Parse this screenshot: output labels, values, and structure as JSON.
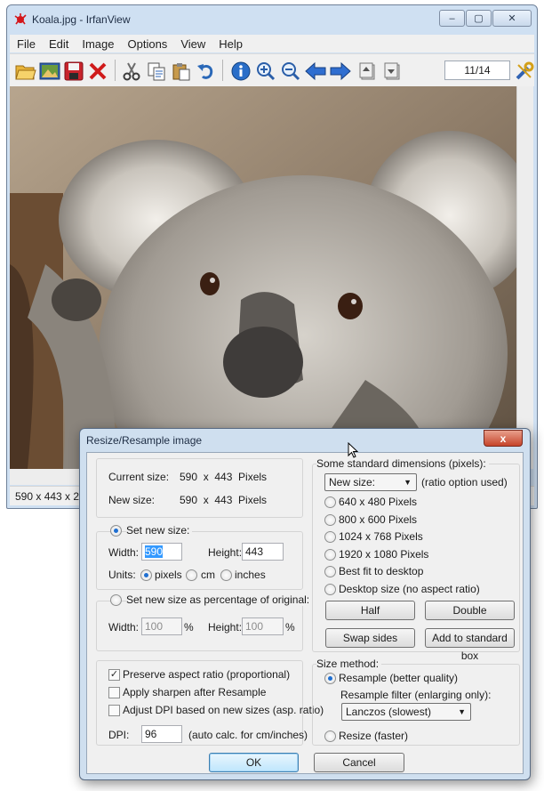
{
  "window": {
    "title": "Koala.jpg - IrfanView",
    "caption_buttons": [
      "‒",
      "▢",
      "✕"
    ]
  },
  "menu": [
    "File",
    "Edit",
    "Image",
    "Options",
    "View",
    "Help"
  ],
  "toolbar": {
    "icons": [
      "open-icon",
      "thumbnails-icon",
      "save-icon",
      "delete-icon",
      "cut-icon",
      "copy-icon",
      "paste-icon",
      "undo-icon",
      "info-icon",
      "zoom-in-icon",
      "zoom-out-icon",
      "previous-icon",
      "next-icon",
      "first-page-icon",
      "last-page-icon",
      "settings-icon"
    ],
    "page_counter": "11/14"
  },
  "status": {
    "text": "590 x 443 x 24"
  },
  "dialog": {
    "title": "Resize/Resample image",
    "close": "x",
    "current_size_label": "Current size:",
    "current_size_value": "590  x  443  Pixels",
    "new_size_label": "New size:",
    "new_size_value": "590  x  443  Pixels",
    "set_new_size": {
      "label": "Set new size:",
      "selected": true,
      "width_label": "Width:",
      "width_value": "590",
      "height_label": "Height:",
      "height_value": "443",
      "units_label": "Units:",
      "units": [
        "pixels",
        "cm",
        "inches"
      ],
      "selected_unit": "pixels"
    },
    "set_percentage": {
      "label": "Set new size as percentage of original:",
      "selected": false,
      "width_label": "Width:",
      "width_value": "100",
      "height_label": "Height:",
      "height_value": "100",
      "percent": "%"
    },
    "standard": {
      "label": "Some standard dimensions (pixels):",
      "combo_value": "New size:",
      "ratio_note": "(ratio option used)",
      "options": [
        "640 x 480 Pixels",
        "800 x 600 Pixels",
        "1024 x 768 Pixels",
        "1920 x 1080 Pixels",
        "Best fit to desktop",
        "Desktop size (no aspect ratio)"
      ],
      "half": "Half",
      "double": "Double",
      "swap": "Swap sides",
      "add": "Add to standard box"
    },
    "checkboxes": [
      {
        "label": "Preserve aspect ratio (proportional)",
        "checked": true
      },
      {
        "label": "Apply sharpen after Resample",
        "checked": false
      },
      {
        "label": "Adjust DPI based on new sizes (asp. ratio)",
        "checked": false
      }
    ],
    "dpi": {
      "label": "DPI:",
      "value": "96",
      "note": "(auto calc. for cm/inches)"
    },
    "size_method": {
      "label": "Size method:",
      "resample": "Resample (better quality)",
      "filter_label": "Resample filter (enlarging only):",
      "filter_value": "Lanczos (slowest)",
      "resize": "Resize (faster)",
      "selected": "resample"
    },
    "ok": "OK",
    "cancel": "Cancel"
  }
}
